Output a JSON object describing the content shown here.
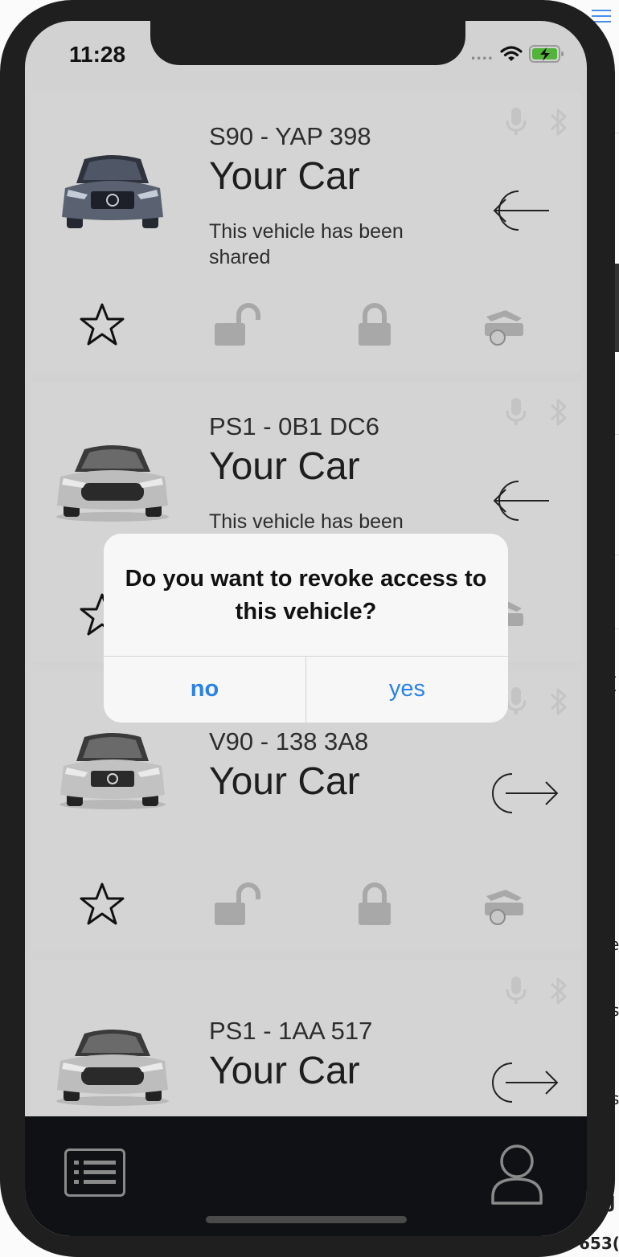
{
  "status_bar": {
    "time": "11:28",
    "signal": "...."
  },
  "vehicles": [
    {
      "plate": "S90 - YAP 398",
      "name": "Your Car",
      "status": "This vehicle has been shared",
      "share_icon": "revoke-arrow-left-icon",
      "favorite": false
    },
    {
      "plate": "PS1 - 0B1 DC6",
      "name": "Your Car",
      "status": "This vehicle has been",
      "share_icon": "revoke-arrow-left-icon",
      "favorite": false
    },
    {
      "plate": "V90 - 138 3A8",
      "name": "Your Car",
      "status": "",
      "share_icon": "share-arrow-right-icon",
      "favorite": false
    },
    {
      "plate": "PS1 - 1AA 517",
      "name": "Your Car",
      "status": "",
      "share_icon": "share-arrow-right-icon",
      "favorite": false
    }
  ],
  "dialog": {
    "message": "Do you want to revoke access to this vehicle?",
    "no_label": "no",
    "yes_label": "yes"
  },
  "tab_bar": {
    "left_icon": "list-icon",
    "right_icon": "profile-icon"
  },
  "background_fragments": [
    "(",
    "e",
    "s",
    "J",
    "s",
    "J",
    "J",
    "653("
  ],
  "colors": {
    "accent": "#2a82e4",
    "tabbar": "#0f1114",
    "dim_background": "#d2d2d2"
  }
}
